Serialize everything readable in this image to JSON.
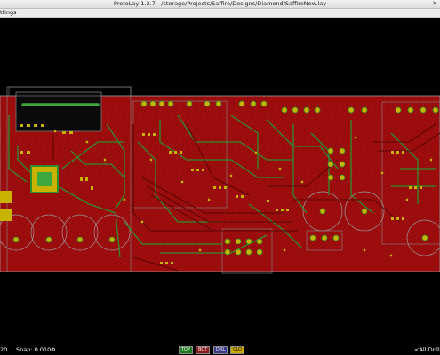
{
  "window": {
    "title": "ProtoLay 1.2.7 - /storage/Projects/Saffire/Designs/Diamond/SaffireNew.lay",
    "close_glyph": "✕"
  },
  "menu": {
    "settings_label": "ttings"
  },
  "status": {
    "left_value": "20",
    "snap": "Snap: 0.010Φ",
    "layers": [
      {
        "label": "TOP",
        "color": "#1e7a1e"
      },
      {
        "label": "BOT",
        "color": "#8b1a1a"
      },
      {
        "label": "DRL",
        "color": "#3a3a8a"
      },
      {
        "label": "CLO",
        "color": "#caa800"
      }
    ],
    "drill": "<All Drill L"
  },
  "colors": {
    "board": "#b01010",
    "top_copper": "#2e8f2e",
    "pad": "#c8b400",
    "outline": "#9a9a9a"
  }
}
